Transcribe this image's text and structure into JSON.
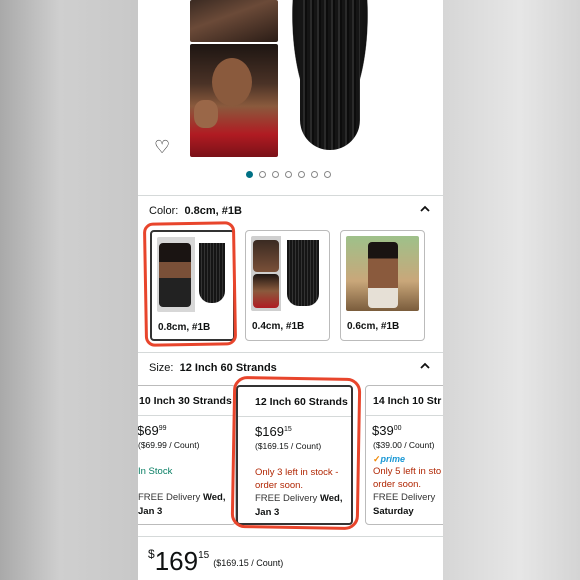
{
  "gallery": {
    "dots_count": 7,
    "active_dot": 0
  },
  "color": {
    "label": "Color:",
    "selected": "0.8cm, #1B",
    "options": [
      {
        "label": "0.8cm, #1B"
      },
      {
        "label": "0.4cm, #1B"
      },
      {
        "label": "0.6cm, #1B"
      }
    ]
  },
  "size": {
    "label": "Size:",
    "selected": "12 Inch 60 Strands",
    "options": [
      {
        "title": "10 Inch 30 Strands",
        "price_whole": "69",
        "price_cents": "99",
        "unit": "($69.99 / Count)",
        "stock_line1": "In Stock",
        "stock_line2": "",
        "delivery_prefix": "FREE Delivery",
        "delivery_date1": "Wed,",
        "delivery_date2": "Jan 3"
      },
      {
        "title": "12 Inch 60 Strands",
        "price_whole": "169",
        "price_cents": "15",
        "unit": "($169.15 / Count)",
        "stock_line1": "Only 3 left in stock -",
        "stock_line2": "order soon.",
        "delivery_prefix": "FREE Delivery",
        "delivery_date1": "Wed,",
        "delivery_date2": "Jan 3"
      },
      {
        "title": "14 Inch 10 Str",
        "price_whole": "39",
        "price_cents": "00",
        "unit": "($39.00 / Count)",
        "prime": "prime",
        "stock_line1": "Only 5 left in sto",
        "stock_line2": "order soon.",
        "delivery_prefix": "FREE Delivery",
        "delivery_date1": "",
        "delivery_date2": "Saturday"
      }
    ]
  },
  "buybox": {
    "currency": "$",
    "price_whole": "169",
    "price_cents": "15",
    "unit": "($169.15 / Count)"
  },
  "colors": {
    "accent": "#007185",
    "in_stock": "#067D62",
    "low_stock": "#B12704",
    "annotation": "#e8452c"
  }
}
